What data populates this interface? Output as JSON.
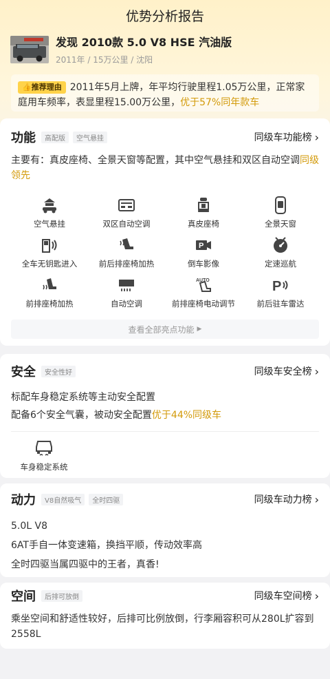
{
  "header": {
    "title": "优势分析报告"
  },
  "car": {
    "name": "发现 2010款 5.0 V8 HSE 汽油版",
    "meta": "2011年 / 15万公里 / 沈阳"
  },
  "recommend": {
    "badge": "推荐理由",
    "text": "2011年5月上牌，年平均行驶里程1.05万公里，正常家庭用车频率，表显里程15.00万公里，",
    "highlight": "优于57%同年款车"
  },
  "function": {
    "title": "功能",
    "tags": [
      "高配版",
      "空气悬挂"
    ],
    "rank": "同级车功能榜",
    "desc": "主要有：真皮座椅、全景天窗等配置，其中空气悬挂和双区自动空调",
    "desc_highlight": "同级领先",
    "items": [
      {
        "label": "空气悬挂",
        "icon": "air-suspension-icon"
      },
      {
        "label": "双区自动空调",
        "icon": "dual-zone-ac-icon"
      },
      {
        "label": "真皮座椅",
        "icon": "leather-seat-icon"
      },
      {
        "label": "全景天窗",
        "icon": "panoramic-sunroof-icon"
      },
      {
        "label": "全车无钥匙进入",
        "icon": "keyless-entry-icon"
      },
      {
        "label": "前后排座椅加热",
        "icon": "seat-heating-icon"
      },
      {
        "label": "倒车影像",
        "icon": "reverse-camera-icon"
      },
      {
        "label": "定速巡航",
        "icon": "cruise-control-icon"
      },
      {
        "label": "前排座椅加热",
        "icon": "front-seat-heating-icon"
      },
      {
        "label": "自动空调",
        "icon": "auto-ac-icon"
      },
      {
        "label": "前排座椅电动调节",
        "icon": "power-seat-icon"
      },
      {
        "label": "前后驻车雷达",
        "icon": "parking-radar-icon"
      }
    ],
    "more": "查看全部亮点功能"
  },
  "safety": {
    "title": "安全",
    "tags": [
      "安全性好"
    ],
    "rank": "同级车安全榜",
    "line1": "标配车身稳定系统等主动安全配置",
    "line2": "配备6个安全气囊，被动安全配置",
    "line2_highlight": "优于44%同级车",
    "items": [
      {
        "label": "车身稳定系统",
        "icon": "stability-control-icon"
      }
    ]
  },
  "power": {
    "title": "动力",
    "tags": [
      "V8自然吸气",
      "全时四驱"
    ],
    "rank": "同级车动力榜",
    "lines": [
      "5.0L V8",
      "6AT手自一体变速箱，换挡平顺，传动效率高",
      "全时四驱当属四驱中的王者，真香!"
    ]
  },
  "space": {
    "title": "空间",
    "tags": [
      "后排可放倒"
    ],
    "rank": "同级车空间榜",
    "desc": "乘坐空间和舒适性较好，后排可比例放倒，行李厢容积可从280L扩容到2558L"
  }
}
